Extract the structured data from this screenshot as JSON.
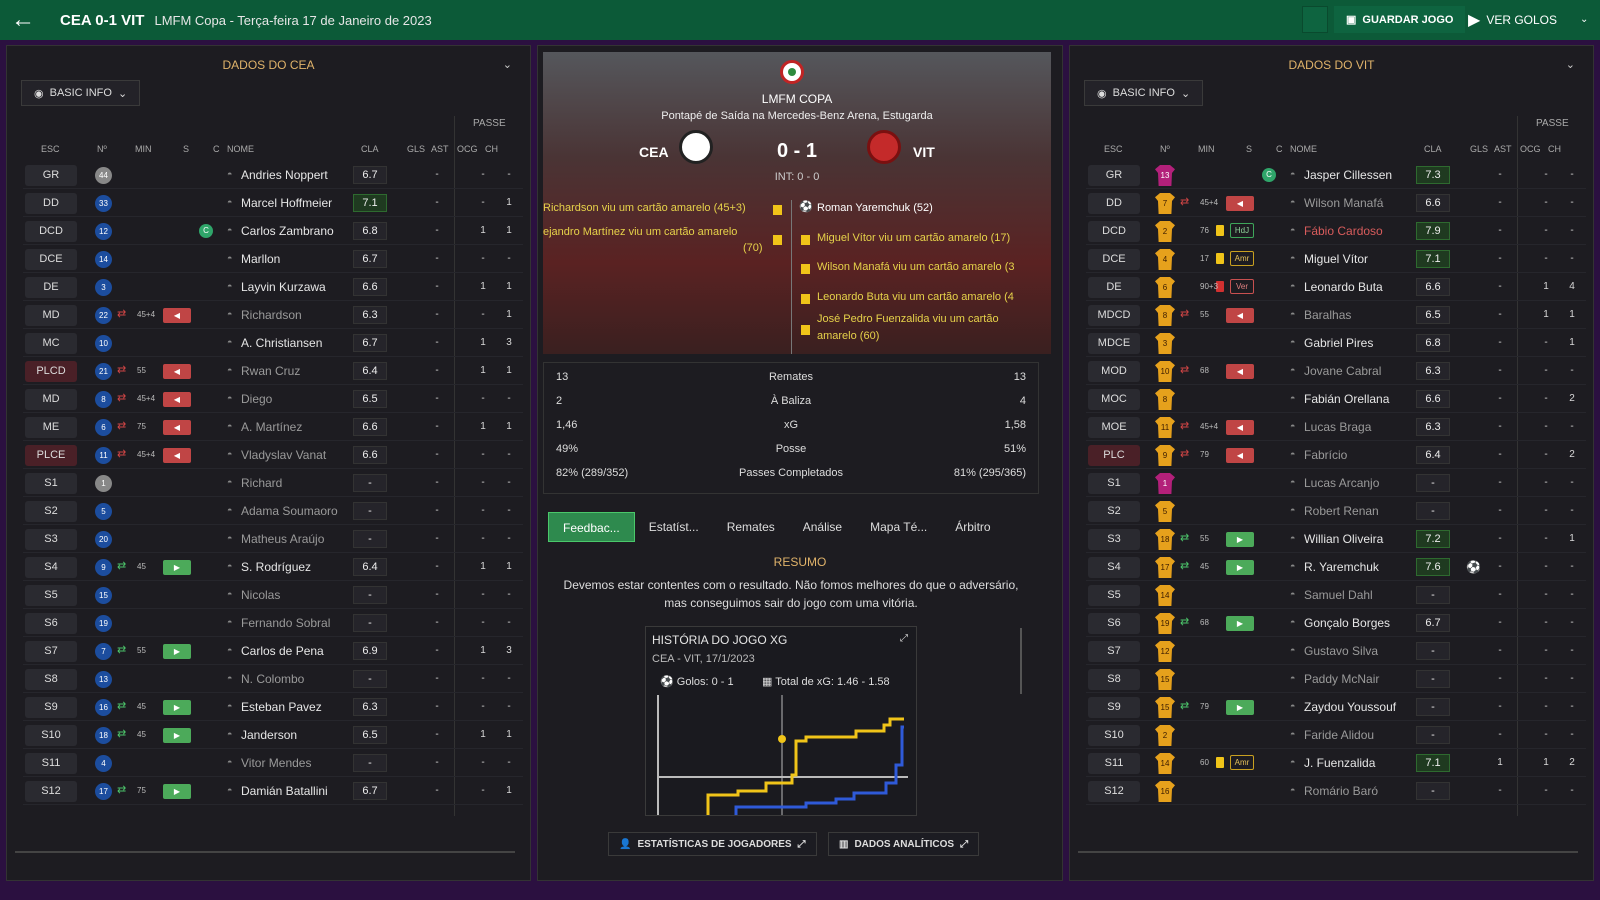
{
  "topbar": {
    "title": "CEA 0-1 VIT",
    "subtitle": "LMFM Copa - Terça-feira 17 de Janeiro de 2023",
    "save": "GUARDAR JOGO",
    "goals": "VER GOLOS"
  },
  "cols": {
    "esc": "ESC",
    "num": "Nº",
    "min": "MIN",
    "s": "S",
    "c": "C",
    "nome": "NOME",
    "cla": "CLA",
    "gls": "GLS",
    "ast": "AST",
    "ogc": "OCG",
    "ch": "CH",
    "passe": "PASSE"
  },
  "left": {
    "title": "DADOS DO CEA",
    "basic": "BASIC INFO",
    "players": [
      {
        "pos": "GR",
        "num": "44",
        "name": "Andries Noppert",
        "cla": "6.7",
        "gls": "-",
        "ast": "-",
        "ch": "-",
        "n": "gray"
      },
      {
        "pos": "DD",
        "num": "33",
        "name": "Marcel Hoffmeier",
        "cla": "7.1",
        "hi": true,
        "gls": "-",
        "ast": "-",
        "ch": "1"
      },
      {
        "pos": "DCD",
        "num": "12",
        "name": "Carlos Zambrano",
        "cla": "6.8",
        "gls": "-",
        "ast": "1",
        "ch": "1",
        "cap": "C"
      },
      {
        "pos": "DCE",
        "num": "14",
        "name": "Marllon",
        "cla": "6.7",
        "gls": "-",
        "ast": "-",
        "ch": "-"
      },
      {
        "pos": "DE",
        "num": "3",
        "name": "Layvin Kurzawa",
        "cla": "6.6",
        "gls": "-",
        "ast": "1",
        "ch": "1"
      },
      {
        "pos": "MD",
        "num": "22",
        "name": "Richardson",
        "cla": "6.3",
        "gls": "-",
        "ast": "-",
        "ch": "1",
        "sub": "out",
        "min": "45+4",
        "dim": true
      },
      {
        "pos": "MC",
        "num": "10",
        "name": "A. Christiansen",
        "cla": "6.7",
        "gls": "-",
        "ast": "1",
        "ch": "3"
      },
      {
        "pos": "PLCD",
        "num": "21",
        "name": "Rwan Cruz",
        "cla": "6.4",
        "gls": "-",
        "ast": "1",
        "ch": "1",
        "sub": "out",
        "min": "55",
        "dim": true,
        "red": true
      },
      {
        "pos": "MD",
        "num": "8",
        "name": "Diego",
        "cla": "6.5",
        "gls": "-",
        "ast": "-",
        "ch": "-",
        "sub": "out",
        "min": "45+4",
        "dim": true
      },
      {
        "pos": "ME",
        "num": "6",
        "name": "A. Martínez",
        "cla": "6.6",
        "gls": "-",
        "ast": "1",
        "ch": "1",
        "sub": "out",
        "min": "75",
        "dim": true
      },
      {
        "pos": "PLCE",
        "num": "11",
        "name": "Vladyslav Vanat",
        "cla": "6.6",
        "gls": "-",
        "ast": "-",
        "ch": "-",
        "sub": "out",
        "min": "45+4",
        "dim": true,
        "red": true
      },
      {
        "pos": "S1",
        "num": "1",
        "name": "Richard",
        "cla": "-",
        "gls": "-",
        "ast": "-",
        "ch": "-",
        "n": "gray",
        "dim": true
      },
      {
        "pos": "S2",
        "num": "5",
        "name": "Adama Soumaoro",
        "cla": "-",
        "gls": "-",
        "ast": "-",
        "ch": "-",
        "dim": true
      },
      {
        "pos": "S3",
        "num": "20",
        "name": "Matheus Araújo",
        "cla": "-",
        "gls": "-",
        "ast": "-",
        "ch": "-",
        "dim": true
      },
      {
        "pos": "S4",
        "num": "9",
        "name": "S. Rodríguez",
        "cla": "6.4",
        "gls": "-",
        "ast": "1",
        "ch": "1",
        "sub": "in",
        "min": "45"
      },
      {
        "pos": "S5",
        "num": "15",
        "name": "Nicolas",
        "cla": "-",
        "gls": "-",
        "ast": "-",
        "ch": "-",
        "dim": true
      },
      {
        "pos": "S6",
        "num": "19",
        "name": "Fernando Sobral",
        "cla": "-",
        "gls": "-",
        "ast": "-",
        "ch": "-",
        "dim": true
      },
      {
        "pos": "S7",
        "num": "7",
        "name": "Carlos de Pena",
        "cla": "6.9",
        "gls": "-",
        "ast": "1",
        "ch": "3",
        "sub": "in",
        "min": "55"
      },
      {
        "pos": "S8",
        "num": "13",
        "name": "N. Colombo",
        "cla": "-",
        "gls": "-",
        "ast": "-",
        "ch": "-",
        "dim": true
      },
      {
        "pos": "S9",
        "num": "16",
        "name": "Esteban Pavez",
        "cla": "6.3",
        "gls": "-",
        "ast": "-",
        "ch": "-",
        "sub": "in",
        "min": "45"
      },
      {
        "pos": "S10",
        "num": "18",
        "name": "Janderson",
        "cla": "6.5",
        "gls": "-",
        "ast": "1",
        "ch": "1",
        "sub": "in",
        "min": "45"
      },
      {
        "pos": "S11",
        "num": "4",
        "name": "Vitor Mendes",
        "cla": "-",
        "gls": "-",
        "ast": "-",
        "ch": "-",
        "dim": true
      },
      {
        "pos": "S12",
        "num": "17",
        "name": "Damián Batallini",
        "cla": "6.7",
        "gls": "-",
        "ast": "-",
        "ch": "1",
        "sub": "in",
        "min": "75"
      }
    ]
  },
  "right": {
    "title": "DADOS DO VIT",
    "basic": "BASIC INFO",
    "players": [
      {
        "pos": "GR",
        "num": "13",
        "name": "Jasper Cillessen",
        "cla": "7.3",
        "hi": true,
        "gls": "-",
        "ast": "-",
        "ch": "-",
        "gk": true,
        "cap": "C"
      },
      {
        "pos": "DD",
        "num": "7",
        "name": "Wilson Manafá",
        "cla": "6.6",
        "gls": "-",
        "ast": "-",
        "ch": "-",
        "sub": "out",
        "min": "45+4",
        "dim": true
      },
      {
        "pos": "DCD",
        "num": "2",
        "name": "Fábio Cardoso",
        "cla": "7.9",
        "hi": true,
        "gls": "-",
        "ast": "-",
        "ch": "-",
        "card": "y",
        "min": "76",
        "badge": "HdJ",
        "bc": "g",
        "namered": true
      },
      {
        "pos": "DCE",
        "num": "4",
        "name": "Miguel Vítor",
        "cla": "7.1",
        "hi": true,
        "gls": "-",
        "ast": "-",
        "ch": "-",
        "card": "y",
        "min": "17",
        "badge": "Amr"
      },
      {
        "pos": "DE",
        "num": "6",
        "name": "Leonardo Buta",
        "cla": "6.6",
        "gls": "-",
        "ast": "1",
        "ch": "4",
        "card": "r",
        "min": "90+3",
        "badge": "Ver",
        "bc": "r"
      },
      {
        "pos": "MDCD",
        "num": "8",
        "name": "Baralhas",
        "cla": "6.5",
        "gls": "-",
        "ast": "1",
        "ch": "1",
        "sub": "out",
        "min": "55",
        "dim": true
      },
      {
        "pos": "MDCE",
        "num": "3",
        "name": "Gabriel Pires",
        "cla": "6.8",
        "gls": "-",
        "ast": "-",
        "ch": "1"
      },
      {
        "pos": "MOD",
        "num": "10",
        "name": "Jovane Cabral",
        "cla": "6.3",
        "gls": "-",
        "ast": "-",
        "ch": "-",
        "sub": "out",
        "min": "68",
        "dim": true
      },
      {
        "pos": "MOC",
        "num": "8",
        "name": "Fabián Orellana",
        "cla": "6.6",
        "gls": "-",
        "ast": "-",
        "ch": "2"
      },
      {
        "pos": "MOE",
        "num": "11",
        "name": "Lucas Braga",
        "cla": "6.3",
        "gls": "-",
        "ast": "-",
        "ch": "-",
        "sub": "out",
        "min": "45+4",
        "dim": true
      },
      {
        "pos": "PLC",
        "num": "9",
        "name": "Fabrício",
        "cla": "6.4",
        "gls": "-",
        "ast": "-",
        "ch": "2",
        "sub": "out",
        "min": "79",
        "dim": true,
        "red": true
      },
      {
        "pos": "S1",
        "num": "1",
        "name": "Lucas Arcanjo",
        "cla": "-",
        "gls": "-",
        "ast": "-",
        "ch": "-",
        "gk": true,
        "dim": true
      },
      {
        "pos": "S2",
        "num": "5",
        "name": "Robert Renan",
        "cla": "-",
        "gls": "-",
        "ast": "-",
        "ch": "-",
        "dim": true
      },
      {
        "pos": "S3",
        "num": "18",
        "name": "Willian Oliveira",
        "cla": "7.2",
        "hi": true,
        "gls": "-",
        "ast": "-",
        "ch": "1",
        "sub": "in",
        "min": "55"
      },
      {
        "pos": "S4",
        "num": "17",
        "name": "R. Yaremchuk",
        "cla": "7.6",
        "hi": true,
        "gls": "-",
        "ast": "-",
        "ch": "-",
        "sub": "in",
        "min": "45",
        "ball": true
      },
      {
        "pos": "S5",
        "num": "14",
        "name": "Samuel Dahl",
        "cla": "-",
        "gls": "-",
        "ast": "-",
        "ch": "-",
        "dim": true
      },
      {
        "pos": "S6",
        "num": "19",
        "name": "Gonçalo Borges",
        "cla": "6.7",
        "gls": "-",
        "ast": "-",
        "ch": "-",
        "sub": "in",
        "min": "68"
      },
      {
        "pos": "S7",
        "num": "12",
        "name": "Gustavo Silva",
        "cla": "-",
        "gls": "-",
        "ast": "-",
        "ch": "-",
        "dim": true
      },
      {
        "pos": "S8",
        "num": "15",
        "name": "Paddy McNair",
        "cla": "-",
        "gls": "-",
        "ast": "-",
        "ch": "-",
        "dim": true
      },
      {
        "pos": "S9",
        "num": "15",
        "name": "Zaydou Youssouf",
        "cla": "-",
        "gls": "-",
        "ast": "-",
        "ch": "-",
        "sub": "in",
        "min": "79"
      },
      {
        "pos": "S10",
        "num": "2",
        "name": "Faride Alidou",
        "cla": "-",
        "gls": "-",
        "ast": "-",
        "ch": "-",
        "dim": true
      },
      {
        "pos": "S11",
        "num": "14",
        "name": "J. Fuenzalida",
        "cla": "7.1",
        "hi": true,
        "gls": "1",
        "ast": "1",
        "ch": "2",
        "card": "y",
        "min": "60",
        "badge": "Amr"
      },
      {
        "pos": "S12",
        "num": "16",
        "name": "Romário Baró",
        "cla": "-",
        "gls": "-",
        "ast": "-",
        "ch": "-",
        "dim": true
      }
    ]
  },
  "match": {
    "competition": "LMFM COPA",
    "kickoff": "Pontapé de Saída na Mercedes-Benz Arena, Estugarda",
    "home": "CEA",
    "away": "VIT",
    "score": "0 - 1",
    "int": "INT: 0 - 0",
    "home_events": [
      "Richardson viu um cartão amarelo (45+3)",
      "ejandro Martínez viu um cartão amarelo",
      "(70)"
    ],
    "away_events": [
      "Roman Yaremchuk (52)",
      "Miguel Vítor viu um cartão amarelo (17)",
      "Wilson Manafá viu um cartão amarelo (3",
      "Leonardo Buta viu um cartão amarelo (4",
      "José Pedro Fuenzalida viu um cartão",
      "amarelo (60)"
    ]
  },
  "stats": [
    {
      "l": "13",
      "label": "Remates",
      "r": "13"
    },
    {
      "l": "2",
      "label": "À Baliza",
      "r": "4"
    },
    {
      "l": "1,46",
      "label": "xG",
      "r": "1,58"
    },
    {
      "l": "49%",
      "label": "Posse",
      "r": "51%"
    },
    {
      "l": "82% (289/352)",
      "label": "Passes Completados",
      "r": "81% (295/365)"
    }
  ],
  "tabs": [
    "Feedbac...",
    "Estatíst...",
    "Remates",
    "Análise",
    "Mapa Té...",
    "Árbitro"
  ],
  "resumo": {
    "title": "RESUMO",
    "text1": "Devemos estar contentes com o resultado. Não fomos melhores do que o adversário,",
    "text2": "mas conseguimos sair do jogo com uma vitória."
  },
  "xg": {
    "title": "HISTÓRIA DO JOGO XG",
    "sub": "CEA - VIT, 17/1/2023",
    "goals": "Golos: 0 - 1",
    "total": "Total de xG: 1.46 - 1.58"
  },
  "bottom": {
    "players": "ESTATÍSTICAS DE JOGADORES",
    "analytics": "DADOS ANALÍTICOS"
  },
  "colors": {
    "accent": "#0c5a38",
    "home_line": "#2f5ad8",
    "away_line": "#f0c419"
  }
}
